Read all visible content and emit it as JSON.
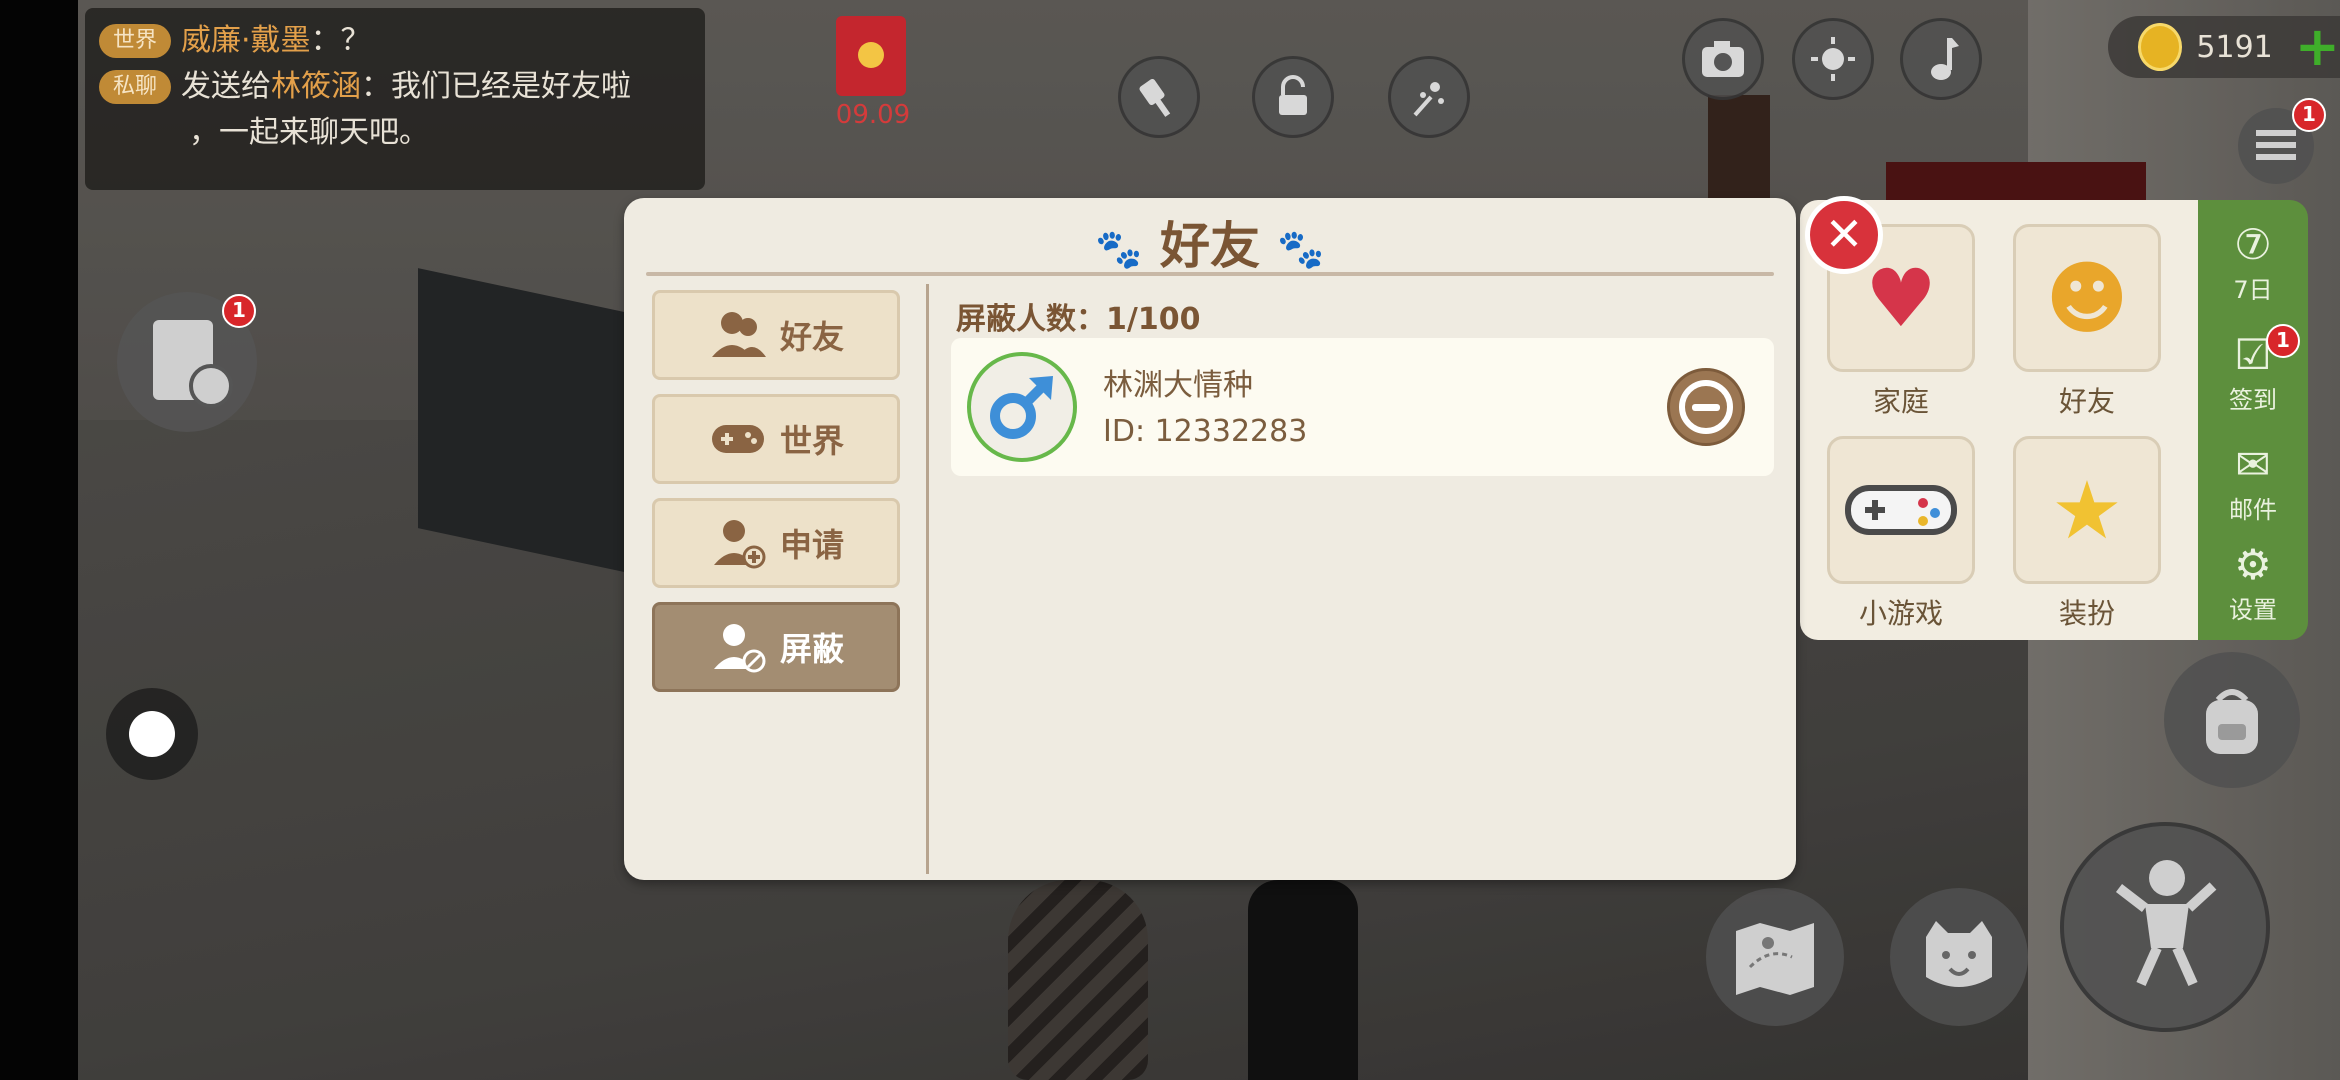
{
  "chat": {
    "line1": {
      "tag": "世界",
      "name": "威廉·戴墨",
      "text": "：？"
    },
    "line2": {
      "tag": "私聊",
      "prefix": "发送给",
      "name": "林筱涵",
      "text": "：我们已经是好友啦"
    },
    "line3": "，一起来聊天吧。"
  },
  "top": {
    "redpack_time": "09.09",
    "coins": "5191",
    "plus": "+"
  },
  "badges": {
    "task": "1",
    "list": "1",
    "signin": "1"
  },
  "side_menu": {
    "items": [
      {
        "label": "家庭",
        "icon": "heart-icon"
      },
      {
        "label": "好友",
        "icon": "friends-icon"
      },
      {
        "label": "小游戏",
        "icon": "gamepad-icon"
      },
      {
        "label": "装扮",
        "icon": "magic-wand-icon"
      }
    ],
    "green": [
      {
        "label": "7日",
        "icon": "seven-day-icon"
      },
      {
        "label": "签到",
        "icon": "checkin-icon"
      },
      {
        "label": "邮件",
        "icon": "mail-icon"
      },
      {
        "label": "设置",
        "icon": "gear-icon"
      }
    ]
  },
  "modal": {
    "title": "好友",
    "tabs": [
      {
        "label": "好友",
        "icon": "friends-icon",
        "active": false
      },
      {
        "label": "世界",
        "icon": "gamepad-icon",
        "active": false
      },
      {
        "label": "申请",
        "icon": "add-friend-icon",
        "active": false
      },
      {
        "label": "屏蔽",
        "icon": "block-user-icon",
        "active": true
      }
    ],
    "count_text": "屏蔽人数：1/100",
    "blocked": [
      {
        "name": "林渊大情种",
        "id": "ID: 12332283",
        "gender_icon": "male-icon"
      }
    ]
  },
  "colors": {
    "accent_brown": "#7a5534",
    "active_tab": "#a38d72",
    "close_red": "#d8323b",
    "coin_gold": "#e6b323",
    "green_panel": "#5d8f3d"
  }
}
